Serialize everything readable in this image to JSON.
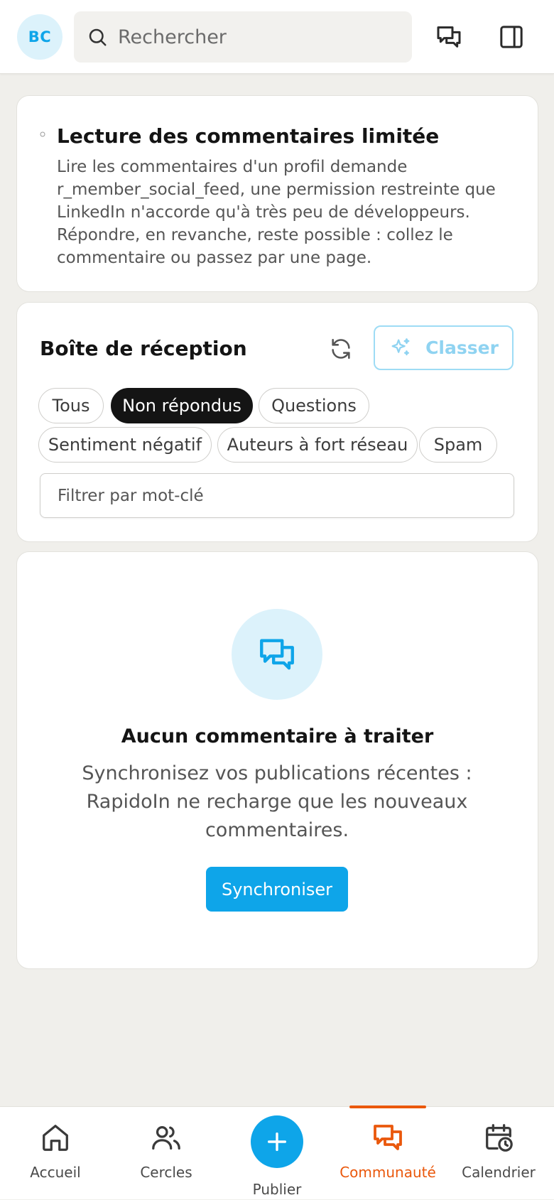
{
  "header": {
    "avatar_initials": "BC",
    "search_placeholder": "Rechercher"
  },
  "notice": {
    "title": "Lecture des commentaires limitée",
    "text": "Lire les commentaires d'un profil demande r_member_social_feed, une permission restreinte que LinkedIn n'accorde qu'à très peu de développeurs. Répondre, en revanche, reste possible : collez le commentaire ou passez par une page."
  },
  "inbox": {
    "title": "Boîte de réception",
    "classify_label": "Classer",
    "filters": [
      {
        "label": "Tous",
        "active": false
      },
      {
        "label": "Non répondus",
        "active": true
      },
      {
        "label": "Questions",
        "active": false
      },
      {
        "label": "Sentiment négatif",
        "active": false
      },
      {
        "label": "Auteurs à fort réseau",
        "active": false
      },
      {
        "label": "Spam",
        "active": false
      }
    ],
    "keyword_placeholder": "Filtrer par mot-clé"
  },
  "empty_state": {
    "title": "Aucun commentaire à traiter",
    "text": "Synchronisez vos publications récentes : RapidoIn ne recharge que les nouveaux commentaires.",
    "button_label": "Synchroniser"
  },
  "bottom_nav": {
    "items": [
      {
        "label": "Accueil",
        "icon": "home-icon",
        "active": false
      },
      {
        "label": "Cercles",
        "icon": "users-icon",
        "active": false
      },
      {
        "label": "Publier",
        "icon": "plus-icon",
        "active": false
      },
      {
        "label": "Communauté",
        "icon": "chat-icon",
        "active": true
      },
      {
        "label": "Calendrier",
        "icon": "calendar-clock-icon",
        "active": false
      }
    ]
  },
  "colors": {
    "accent": "#0ea5e9",
    "active_nav": "#ea580c",
    "background": "#f0efeb",
    "chip_active": "#141414"
  }
}
